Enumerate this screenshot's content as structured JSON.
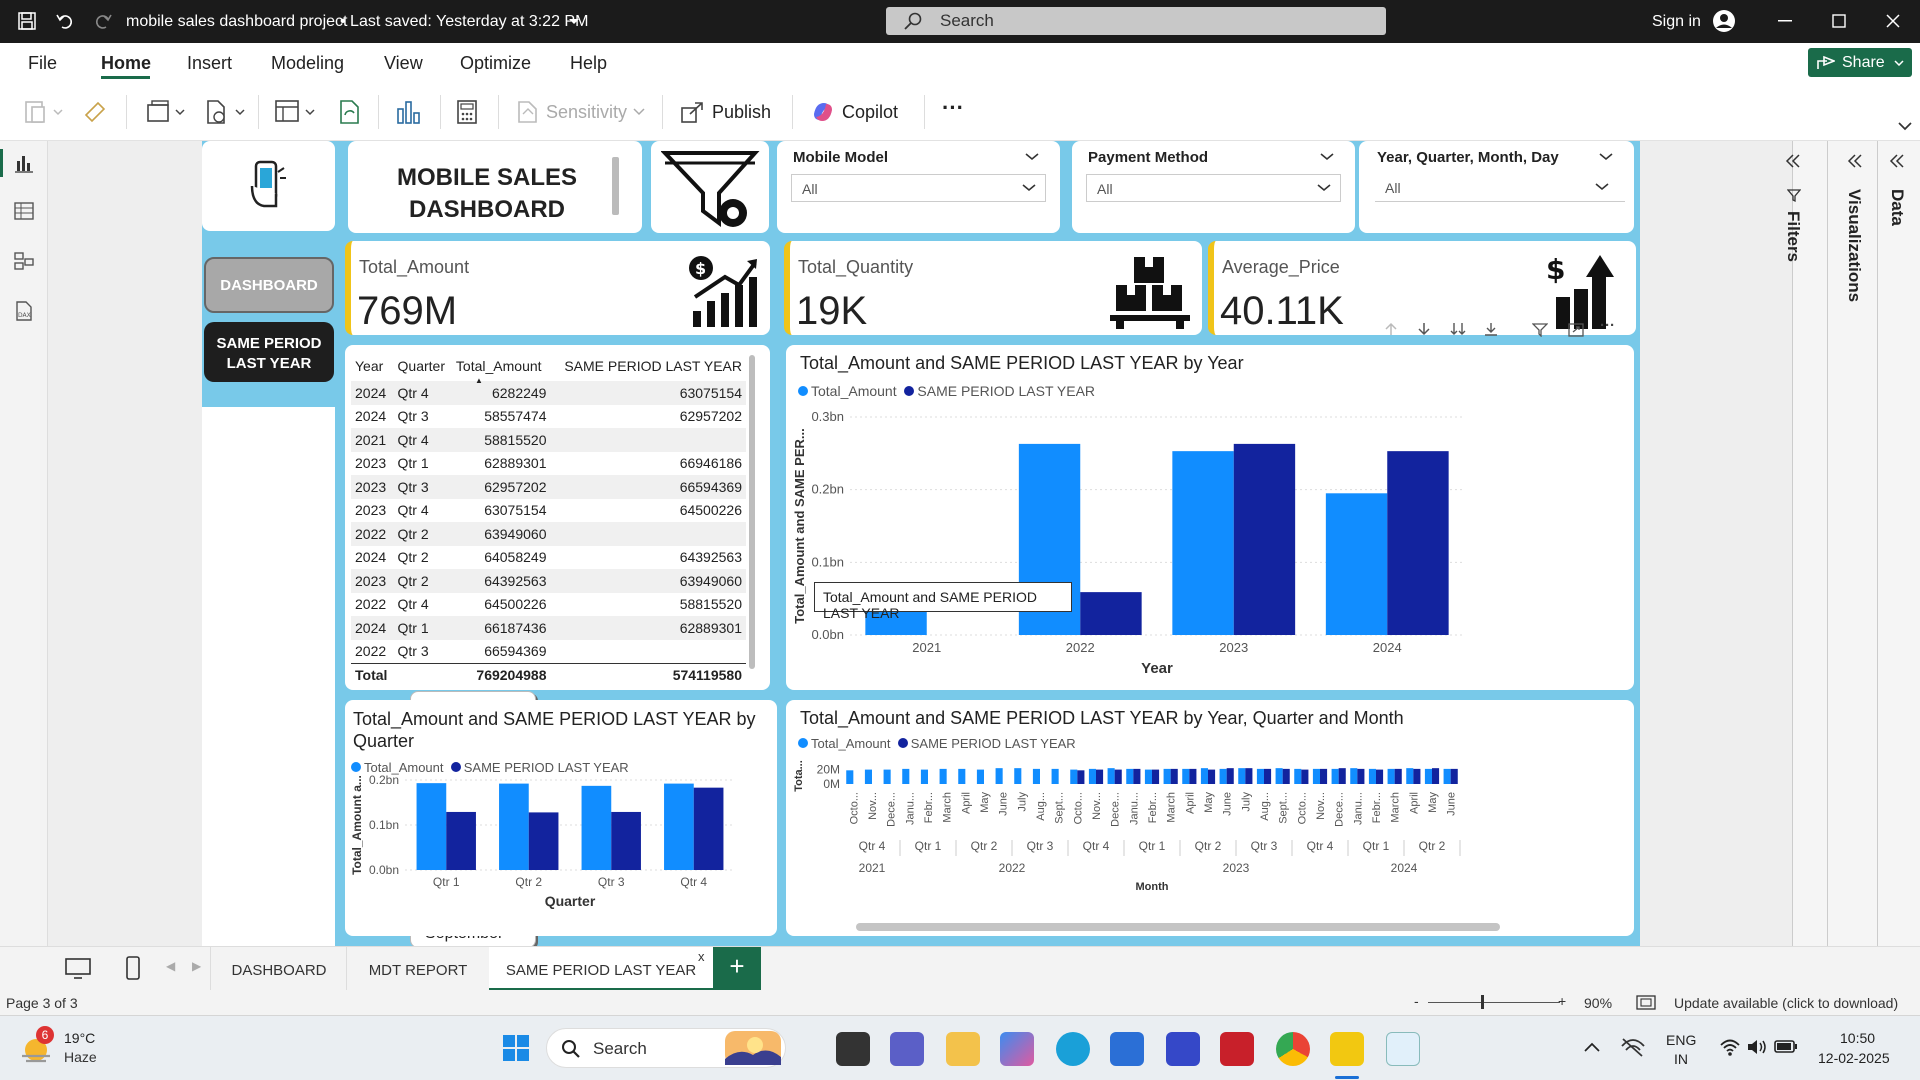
{
  "titlebar": {
    "title": "mobile sales dashboard project",
    "saved": "• Last saved: Yesterday at 3:22 PM",
    "search": "Search",
    "signin": "Sign in"
  },
  "menu": [
    "File",
    "Home",
    "Insert",
    "Modeling",
    "View",
    "Optimize",
    "Help"
  ],
  "share": "Share",
  "ribbon": {
    "sensitivity": "Sensitivity",
    "publish": "Publish",
    "copilot": "Copilot",
    "more": "···"
  },
  "header": {
    "title_line1": "MOBILE SALES",
    "title_line2": "DASHBOARD"
  },
  "slicers": [
    {
      "title": "Mobile Model",
      "value": "All"
    },
    {
      "title": "Payment Method",
      "value": "All"
    },
    {
      "title": "Year, Quarter, Month, Day",
      "value": "All"
    }
  ],
  "nav": {
    "dashboard": "DASHBOARD",
    "same_period_1": "SAME PERIOD",
    "same_period_2": "LAST YEAR"
  },
  "months": [
    "January",
    "February",
    "March",
    "April",
    "May",
    "June",
    "July",
    "August",
    "September",
    "October",
    "November",
    "December"
  ],
  "kpis": [
    {
      "label": "Total_Amount",
      "value": "769M"
    },
    {
      "label": "Total_Quantity",
      "value": "19K"
    },
    {
      "label": "Average_Price",
      "value": "40.11K"
    }
  ],
  "table": {
    "headers": [
      "Year",
      "Quarter",
      "Total_Amount",
      "SAME PERIOD LAST YEAR"
    ],
    "rows": [
      [
        "2024",
        "Qtr 4",
        "6282249",
        "63075154"
      ],
      [
        "2024",
        "Qtr 3",
        "58557474",
        "62957202"
      ],
      [
        "2021",
        "Qtr 4",
        "58815520",
        ""
      ],
      [
        "2023",
        "Qtr 1",
        "62889301",
        "66946186"
      ],
      [
        "2023",
        "Qtr 3",
        "62957202",
        "66594369"
      ],
      [
        "2023",
        "Qtr 4",
        "63075154",
        "64500226"
      ],
      [
        "2022",
        "Qtr 2",
        "63949060",
        ""
      ],
      [
        "2024",
        "Qtr 2",
        "64058249",
        "64392563"
      ],
      [
        "2023",
        "Qtr 2",
        "64392563",
        "63949060"
      ],
      [
        "2022",
        "Qtr 4",
        "64500226",
        "58815520"
      ],
      [
        "2024",
        "Qtr 1",
        "66187436",
        "62889301"
      ],
      [
        "2022",
        "Qtr 3",
        "66594369",
        ""
      ]
    ],
    "total": [
      "Total",
      "",
      "769204988",
      "574119580"
    ]
  },
  "colors": {
    "total_amount": "#118dff",
    "same_period": "#12239e",
    "report_bg": "#78c9e9"
  },
  "legend": {
    "a": "Total_Amount",
    "b": "SAME PERIOD LAST YEAR"
  },
  "chart_data": [
    {
      "type": "bar",
      "title": "Total_Amount and SAME PERIOD LAST YEAR by Year",
      "categories": [
        "2021",
        "2022",
        "2023",
        "2024"
      ],
      "series": [
        {
          "name": "Total_Amount",
          "values": [
            0.059,
            0.263,
            0.253,
            0.195
          ]
        },
        {
          "name": "SAME PERIOD LAST YEAR",
          "values": [
            0,
            0.059,
            0.263,
            0.253
          ]
        }
      ],
      "xlabel": "Year",
      "ylabel": "Total_Amount and SAME PER...",
      "yticks": [
        "0.0bn",
        "0.1bn",
        "0.2bn",
        "0.3bn"
      ],
      "ylim": [
        0,
        0.3
      ],
      "tooltip": "Total_Amount and SAME PERIOD LAST YEAR"
    },
    {
      "type": "bar",
      "title": "Total_Amount and SAME PERIOD LAST YEAR by Quarter",
      "categories": [
        "Qtr 1",
        "Qtr 2",
        "Qtr 3",
        "Qtr 4"
      ],
      "series": [
        {
          "name": "Total_Amount",
          "values": [
            0.193,
            0.192,
            0.187,
            0.192
          ]
        },
        {
          "name": "SAME PERIOD LAST YEAR",
          "values": [
            0.129,
            0.128,
            0.129,
            0.183
          ]
        }
      ],
      "xlabel": "Quarter",
      "ylabel": "Total_Amount a...",
      "yticks": [
        "0.0bn",
        "0.1bn",
        "0.2bn"
      ],
      "ylim": [
        0,
        0.2
      ]
    },
    {
      "type": "bar",
      "title": "Total_Amount and SAME PERIOD LAST YEAR by Year, Quarter and Month",
      "categories": [
        "Octo...",
        "Nov...",
        "Dece...",
        "Janu...",
        "Febr...",
        "March",
        "April",
        "May",
        "June",
        "July",
        "Aug...",
        "Sept...",
        "Octo...",
        "Nov...",
        "Dece...",
        "Janu...",
        "Febr...",
        "March",
        "April",
        "May",
        "June",
        "July",
        "Aug...",
        "Sept...",
        "Octo...",
        "Nov...",
        "Dece...",
        "Janu...",
        "Febr...",
        "March",
        "April",
        "May",
        "June"
      ],
      "quarters": [
        {
          "label": "Qtr 4",
          "span": 3
        },
        {
          "label": "Qtr 1",
          "span": 3
        },
        {
          "label": "Qtr 2",
          "span": 3
        },
        {
          "label": "Qtr 3",
          "span": 3
        },
        {
          "label": "Qtr 4",
          "span": 3
        },
        {
          "label": "Qtr 1",
          "span": 3
        },
        {
          "label": "Qtr 2",
          "span": 3
        },
        {
          "label": "Qtr 3",
          "span": 3
        },
        {
          "label": "Qtr 4",
          "span": 3
        },
        {
          "label": "Qtr 1",
          "span": 3
        },
        {
          "label": "Qtr 2",
          "span": 3
        }
      ],
      "years": [
        {
          "label": "2021",
          "span": 3
        },
        {
          "label": "2022",
          "span": 12
        },
        {
          "label": "2023",
          "span": 12
        },
        {
          "label": "2024",
          "span": 6
        }
      ],
      "series": [
        {
          "name": "Total_Amount",
          "values": [
            19,
            20,
            20,
            21,
            20,
            21,
            21,
            20,
            22,
            22,
            21,
            21,
            20,
            21,
            22,
            21,
            20,
            21,
            21,
            22,
            21,
            22,
            21,
            22,
            21,
            21,
            21,
            22,
            21,
            21,
            22,
            21,
            21
          ]
        },
        {
          "name": "SAME PERIOD LAST YEAR",
          "values": [
            0,
            0,
            0,
            0,
            0,
            0,
            0,
            0,
            0,
            0,
            0,
            0,
            19,
            20,
            20,
            21,
            20,
            21,
            21,
            20,
            22,
            22,
            21,
            21,
            20,
            21,
            22,
            21,
            20,
            21,
            21,
            22,
            21
          ]
        }
      ],
      "xlabel": "Month",
      "ylabel": "Tota...",
      "yticks": [
        "0M",
        "20M"
      ],
      "ylim": [
        0,
        25
      ]
    }
  ],
  "pane": {
    "filters": "Filters",
    "visualizations": "Visualizations",
    "data": "Data"
  },
  "tabs": [
    "DASHBOARD",
    "MDT REPORT",
    "SAME PERIOD LAST YEAR"
  ],
  "tab_add": "+",
  "tab_close": "x",
  "status": {
    "page": "Page 3 of 3",
    "zoom_minus": "-",
    "zoom_plus": "+",
    "zoom": "90%",
    "update": "Update available (click to download)"
  },
  "taskbar": {
    "temp": "19°C",
    "weather": "Haze",
    "badge": "6",
    "search": "Search",
    "lang1": "ENG",
    "lang2": "IN",
    "time": "10:50",
    "date": "12-02-2025"
  }
}
